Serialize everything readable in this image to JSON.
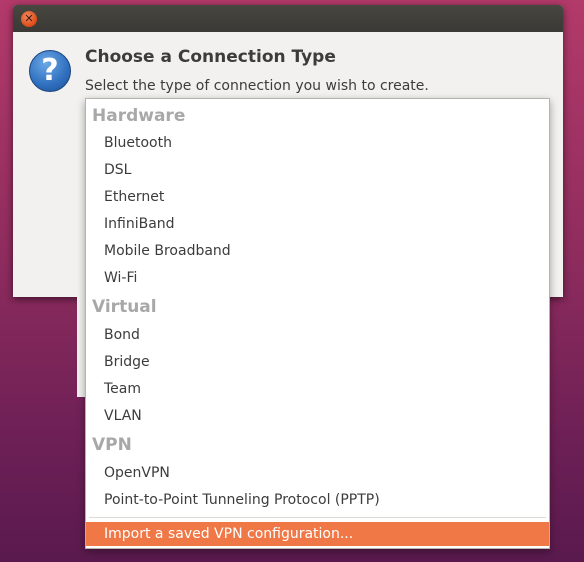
{
  "dialog": {
    "title": "Choose a Connection Type",
    "subtitle": "Select the type of connection you wish to create."
  },
  "menu": {
    "sections": [
      {
        "header": "Hardware",
        "items": [
          "Bluetooth",
          "DSL",
          "Ethernet",
          "InfiniBand",
          "Mobile Broadband",
          "Wi-Fi"
        ]
      },
      {
        "header": "Virtual",
        "items": [
          "Bond",
          "Bridge",
          "Team",
          "VLAN"
        ]
      },
      {
        "header": "VPN",
        "items": [
          "OpenVPN",
          "Point-to-Point Tunneling Protocol (PPTP)"
        ]
      }
    ],
    "import_label": "Import a saved VPN configuration..."
  },
  "colors": {
    "accent": "#f07746",
    "section_header": "#a8a8a8"
  },
  "icons": {
    "close": "close-icon",
    "dialog": "question-icon"
  }
}
